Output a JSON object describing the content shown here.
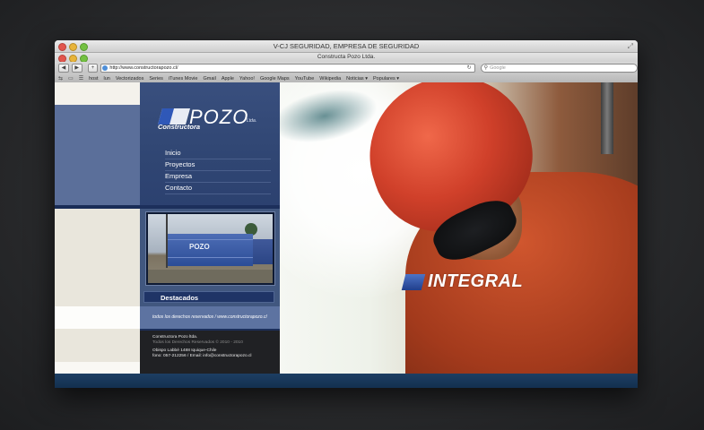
{
  "browser": {
    "window_title": "V-CJ SEGURIDAD, EMPRESA DE SEGURIDAD",
    "tab_title": "Constructa Pozo Ltda.",
    "url": "http://www.constructorapozo.cl/",
    "search_placeholder": "Google",
    "bookmarks": [
      "host",
      "lun",
      "Vectorizados",
      "Series",
      "iTunes Movie",
      "Gmail",
      "Apple",
      "Yahoo!",
      "Google Maps",
      "YouTube",
      "Wikipedia",
      "Noticias ▾",
      "Populares ▾"
    ]
  },
  "site": {
    "logo_word": "POZO",
    "logo_sub": "Constructora",
    "logo_ltda": "Ltda.",
    "menu": [
      "Inicio",
      "Proyectos",
      "Empresa",
      "Contacto"
    ],
    "photo_label": "POZO",
    "destacados": "Destacados",
    "rights": "todos los derechos reservados / www.constructorapozo.cl",
    "footer": {
      "company": "Constructora Pozo ltda.",
      "copyright": "Todos los Derechos Reservados © 2010 - 2010",
      "address": "Obispo Labbé 1488 Iquique-Chile",
      "contact": "fono: 057-212256 / Email: info@constructorapozo.cl"
    },
    "hero_word": "INTEGRAL"
  }
}
